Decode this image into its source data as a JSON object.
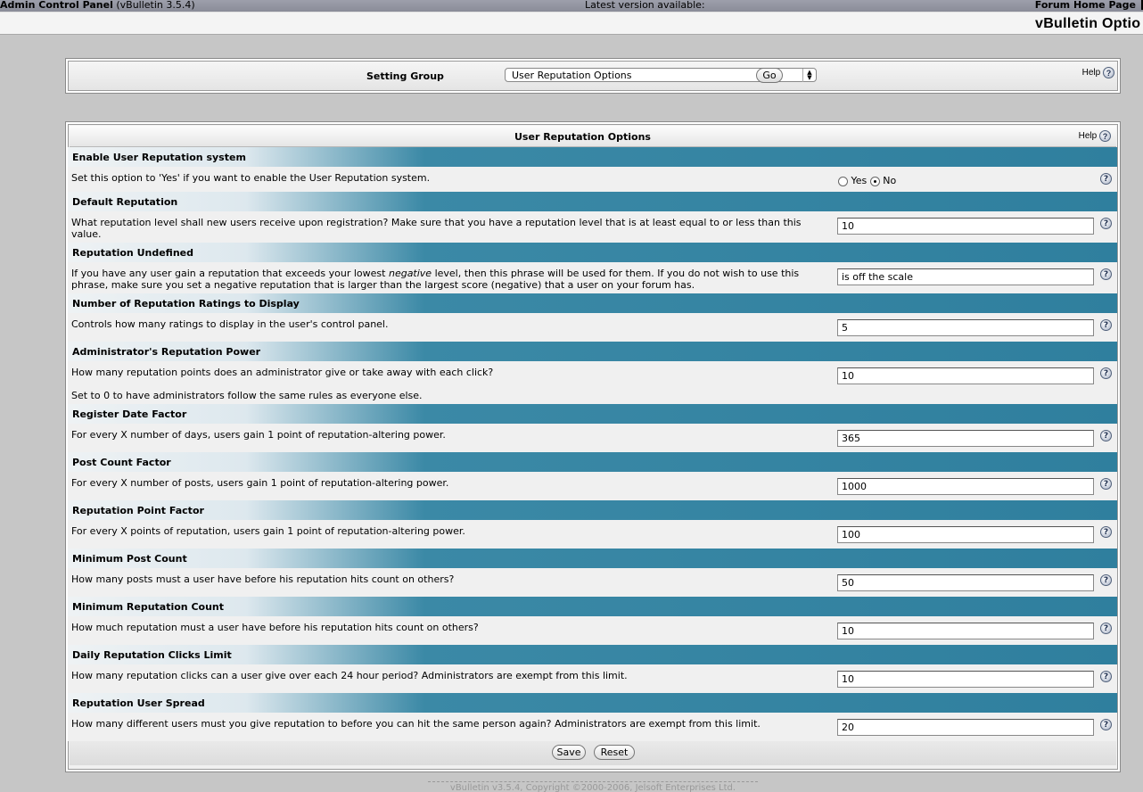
{
  "header": {
    "app_title": "Admin Control Panel",
    "version": "(vBulletin 3.5.4)",
    "latest_version": "Latest version available:",
    "forum_home": "Forum Home Page",
    "page_title": "vBulletin Optio"
  },
  "setting_group": {
    "label": "Setting Group",
    "selected": "User Reputation Options",
    "go_label": "Go",
    "help_label": "Help"
  },
  "panel": {
    "title": "User Reputation Options",
    "help_label": "Help",
    "save_label": "Save",
    "reset_label": "Reset"
  },
  "settings": [
    {
      "title": "Enable User Reputation system",
      "desc": "Set this option to 'Yes' if you want to enable the User Reputation system.",
      "type": "radio",
      "yes_label": "Yes",
      "no_label": "No",
      "selected": "No"
    },
    {
      "title": "Default Reputation",
      "desc": "What reputation level shall new users receive upon registration? Make sure that you have a reputation level that is at least equal to or less than this value.",
      "value": "10"
    },
    {
      "title": "Reputation Undefined",
      "desc_pre": "If you have any user gain a reputation that exceeds your lowest ",
      "desc_em": "negative",
      "desc_post": " level, then this phrase will be used for them. If you do not wish to use this phrase, make sure you set a negative reputation that is larger than the largest score (negative) that a user on your forum has.",
      "value": "is off the scale"
    },
    {
      "title": "Number of Reputation Ratings to Display",
      "desc": "Controls how many ratings to display in the user's control panel.",
      "value": "5"
    },
    {
      "title": "Administrator's Reputation Power",
      "desc": "How many reputation points does an administrator give or take away with each click?",
      "note": "Set to 0 to have administrators follow the same rules as everyone else.",
      "value": "10"
    },
    {
      "title": "Register Date Factor",
      "desc": "For every X number of days, users gain 1 point of reputation-altering power.",
      "value": "365"
    },
    {
      "title": "Post Count Factor",
      "desc": "For every X number of posts, users gain 1 point of reputation-altering power.",
      "value": "1000"
    },
    {
      "title": "Reputation Point Factor",
      "desc": "For every X points of reputation, users gain 1 point of reputation-altering power.",
      "value": "100"
    },
    {
      "title": "Minimum Post Count",
      "desc": "How many posts must a user have before his reputation hits count on others?",
      "value": "50"
    },
    {
      "title": "Minimum Reputation Count",
      "desc": "How much reputation must a user have before his reputation hits count on others?",
      "value": "10"
    },
    {
      "title": "Daily Reputation Clicks Limit",
      "desc": "How many reputation clicks can a user give over each 24 hour period? Administrators are exempt from this limit.",
      "value": "10"
    },
    {
      "title": "Reputation User Spread",
      "desc": "How many different users must you give reputation to before you can hit the same person again? Administrators are exempt from this limit.",
      "value": "20"
    }
  ],
  "footer": {
    "copyright": "vBulletin v3.5.4, Copyright ©2000-2006, Jelsoft Enterprises Ltd."
  }
}
